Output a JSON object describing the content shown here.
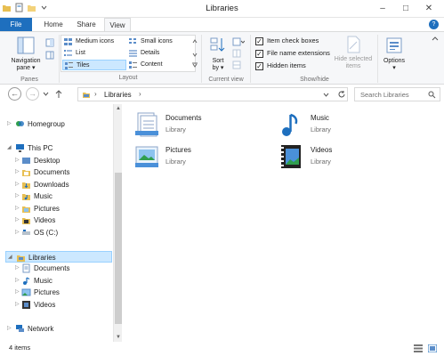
{
  "window": {
    "title": "Libraries"
  },
  "ribbon_tabs": {
    "file": "File",
    "home": "Home",
    "share": "Share",
    "view": "View"
  },
  "panes": {
    "nav_pane_label_1": "Navigation",
    "nav_pane_label_2": "pane ▾",
    "group": "Panes"
  },
  "layout": {
    "group": "Layout",
    "items": [
      "Medium icons",
      "Small icons",
      "List",
      "Details",
      "Tiles",
      "Content"
    ]
  },
  "current_view": {
    "sort_label_1": "Sort",
    "sort_label_2": "by ▾",
    "group": "Current view"
  },
  "show_hide": {
    "group": "Show/hide",
    "item_check_boxes": "Item check boxes",
    "file_name_extensions": "File name extensions",
    "hidden_items": "Hidden items",
    "hide_selected_1": "Hide selected",
    "hide_selected_2": "items",
    "check_mark": "✓"
  },
  "options": {
    "label_1": "Options",
    "label_2": "▾"
  },
  "address": {
    "path": "Libraries",
    "search_placeholder": "Search Libraries"
  },
  "nav_tree": {
    "homegroup": "Homegroup",
    "this_pc": "This PC",
    "pc_children": [
      "Desktop",
      "Documents",
      "Downloads",
      "Music",
      "Pictures",
      "Videos",
      "OS (C:)"
    ],
    "libraries": "Libraries",
    "lib_children": [
      "Documents",
      "Music",
      "Pictures",
      "Videos"
    ],
    "network": "Network"
  },
  "libraries": [
    {
      "name": "Documents",
      "type": "Library"
    },
    {
      "name": "Music",
      "type": "Library"
    },
    {
      "name": "Pictures",
      "type": "Library"
    },
    {
      "name": "Videos",
      "type": "Library"
    }
  ],
  "status": {
    "item_count": "4 items"
  },
  "colors": {
    "accent": "#1e6fbe",
    "selection": "#cce8ff",
    "folder": "#e8bf52"
  }
}
